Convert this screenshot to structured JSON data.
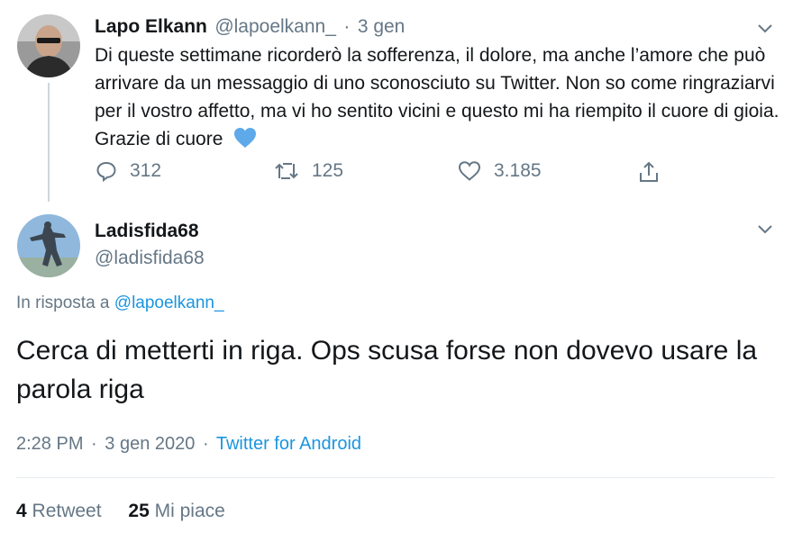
{
  "parent_tweet": {
    "name": "Lapo Elkann",
    "handle": "@lapoelkann_",
    "separator": "·",
    "date": "3 gen",
    "text": "Di queste settimane ricorderò la sofferenza, il dolore, ma anche l’amore che può arrivare da un messaggio di uno sconosciuto su Twitter. Non so come ringraziarvi per il vostro affetto, ma vi ho sentito vicini e questo mi ha riempito il cuore di gioia. Grazie di cuore",
    "emoji": "blue-heart-icon",
    "replies": "312",
    "retweets": "125",
    "likes": "3.185"
  },
  "main_tweet": {
    "name": "Ladisfida68",
    "handle": "@ladisfida68",
    "reply_prefix": "In risposta a",
    "reply_handle": "@lapoelkann_",
    "text": "Cerca di metterti in riga. Ops scusa forse non dovevo usare la parola riga",
    "time": "2:28 PM",
    "separator1": "·",
    "date": "3 gen 2020",
    "separator2": "·",
    "source": "Twitter for Android"
  },
  "stats": {
    "retweet_count": "4",
    "retweet_label": "Retweet",
    "like_count": "25",
    "like_label": "Mi piace"
  },
  "colors": {
    "link": "#1b95e0",
    "muted": "#657786",
    "text": "#14171a",
    "heart": "#5da9e9"
  }
}
